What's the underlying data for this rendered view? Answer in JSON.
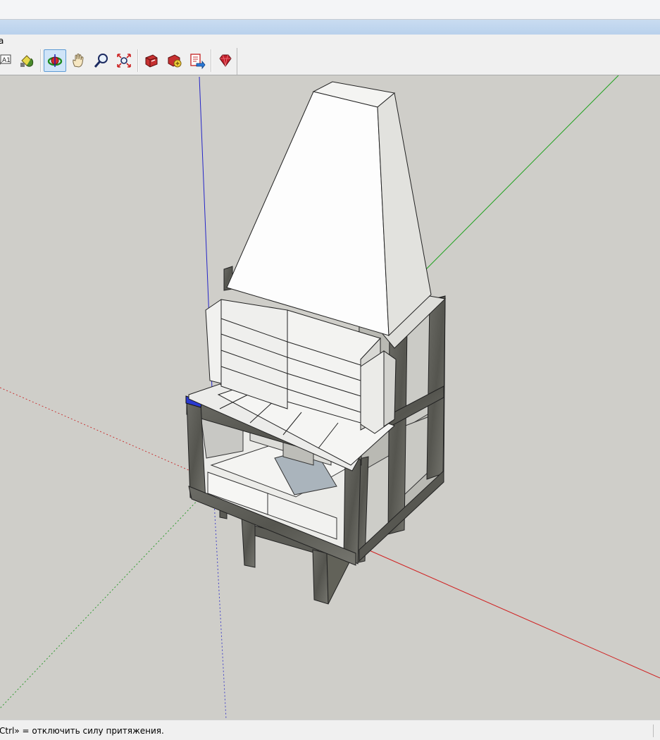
{
  "menubar": {
    "item_fragment": "a"
  },
  "toolbar": {
    "buttons": [
      {
        "name": "text-tool",
        "label": "A1"
      },
      {
        "name": "paint-bucket"
      },
      {
        "name": "orbit",
        "active": true
      },
      {
        "name": "pan"
      },
      {
        "name": "zoom"
      },
      {
        "name": "zoom-extents"
      },
      {
        "name": "get-models"
      },
      {
        "name": "share-model"
      },
      {
        "name": "share-component"
      },
      {
        "name": "extension-warehouse"
      }
    ]
  },
  "status": {
    "hint": "Ctrl» = отключить силу притяжения."
  },
  "colors": {
    "viewport_bg": "#cfcec9",
    "axis_red": "#d02020",
    "axis_green": "#1ba11b",
    "axis_blue": "#2525c8",
    "active_tool_bg": "#cfe4f8"
  }
}
